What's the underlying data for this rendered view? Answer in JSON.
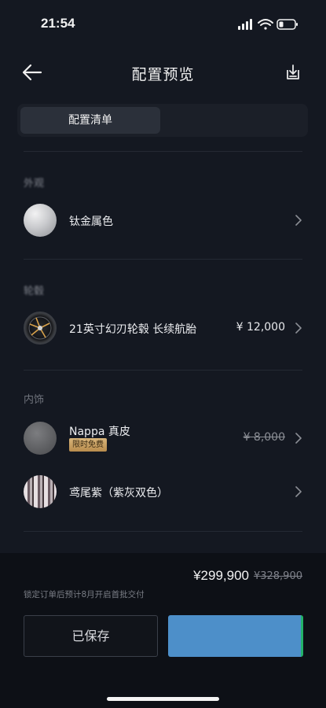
{
  "status_bar": {
    "time": "21:54"
  },
  "header": {
    "title": "配置预览"
  },
  "tabs": [
    {
      "label": "配置清单",
      "active": true
    },
    {
      "label": "",
      "active": false
    }
  ],
  "sections": [
    {
      "label": "外观",
      "items": [
        {
          "name": "钛金属色",
          "price": "",
          "icon": "titanium-swatch"
        }
      ]
    },
    {
      "label": "轮毂",
      "items": [
        {
          "name": "21英寸幻刃轮毂 长续航胎",
          "price": "¥ 12,000",
          "icon": "wheel-swatch"
        }
      ]
    },
    {
      "label": "内饰",
      "items": [
        {
          "name": "Nappa 真皮",
          "badge": "限时免费",
          "price": "¥ 8,000",
          "price_struck": true,
          "icon": "nappa-swatch"
        },
        {
          "name": "鸢尾紫（紫灰双色）",
          "price": "",
          "icon": "purple-swatch"
        }
      ]
    }
  ],
  "footer": {
    "price": "¥299,900",
    "original_price": "¥328,900",
    "delivery_note": "锁定订单后预计8月开启首批交付",
    "saved_label": "已保存",
    "primary_label": ""
  },
  "colors": {
    "background": "#141821",
    "panel": "#0d1016",
    "primary": "#4d8fc9",
    "badge": "#d9b57a"
  }
}
